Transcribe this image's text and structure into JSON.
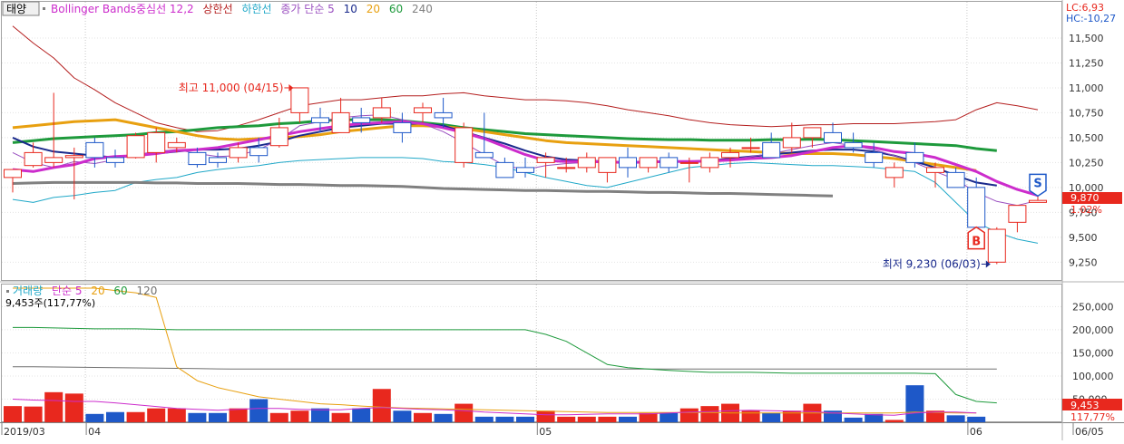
{
  "price_legend": {
    "tag": "태양",
    "bb": "Bollinger Bands중심선 12,2",
    "upper": "상한선",
    "lower": "하한선",
    "ma": "종가 단순 5",
    "p10": "10",
    "p20": "20",
    "p60": "60",
    "p240": "240"
  },
  "vol_legend": {
    "title": "거래량",
    "ma": "단순 5",
    "p20": "20",
    "p60": "60",
    "p120": "120",
    "info": "9,453주(117,77%)"
  },
  "info": {
    "lc": "LC:6,93",
    "hc": "HC:-10,27"
  },
  "badges": {
    "price": "9,870",
    "price_pct": "1.02%",
    "vol": "9,453",
    "vol_pct": "117,77%",
    "buy": "B",
    "sell": "S"
  },
  "colors": {
    "up": "#e8281e",
    "down": "#1e58c8",
    "bb_mid": "#cc2ccc",
    "bb_upper": "#b41e1e",
    "bb_lower": "#20a8c8",
    "ma5": "#9a4fc0",
    "ma10": "#1a2a8c",
    "ma20": "#e8a010",
    "ma60": "#1e9a3c",
    "ma240": "#808080",
    "badge": "#e8281e"
  },
  "chart_data": [
    {
      "type": "candlestick",
      "y_ticks": [
        11500,
        11250,
        11000,
        10750,
        10500,
        10250,
        10000,
        9750,
        9500,
        9250
      ],
      "y_tick_labels": [
        "11,500",
        "11,250",
        "11,000",
        "10,750",
        "10,500",
        "10,250",
        "10,000",
        "9,750",
        "9,500",
        "9,250"
      ],
      "ylim": [
        9080,
        11700
      ],
      "x_tick_labels": [
        "2019/03",
        "04",
        "05",
        "06",
        "06/05"
      ],
      "x_tick_index": [
        0,
        4,
        26,
        47,
        53
      ],
      "annotations": [
        {
          "text": "최고 11,000 (04/15)",
          "index": 14,
          "value": 11000
        },
        {
          "text": "최저 9,230 (06/03)",
          "index": 48,
          "value": 9230
        }
      ],
      "signals": [
        {
          "type": "buy",
          "index": 47,
          "value": 9620
        },
        {
          "type": "sell",
          "index": 50,
          "value": 9950
        }
      ],
      "ohlc": [
        [
          10100,
          10150,
          9950,
          10180
        ],
        [
          10220,
          10450,
          10200,
          10350
        ],
        [
          10250,
          10950,
          10200,
          10300
        ],
        [
          10300,
          10400,
          9880,
          10320
        ],
        [
          10450,
          10500,
          10200,
          10300
        ],
        [
          10300,
          10380,
          10200,
          10250
        ],
        [
          10300,
          10550,
          10290,
          10520
        ],
        [
          10350,
          10600,
          10250,
          10550
        ],
        [
          10400,
          10500,
          10350,
          10450
        ],
        [
          10350,
          10400,
          10200,
          10230
        ],
        [
          10300,
          10350,
          10200,
          10250
        ],
        [
          10300,
          10450,
          10250,
          10400
        ],
        [
          10400,
          10500,
          10250,
          10320
        ],
        [
          10420,
          10700,
          10400,
          10600
        ],
        [
          10750,
          11000,
          10650,
          11000
        ],
        [
          10700,
          10800,
          10550,
          10650
        ],
        [
          10550,
          10900,
          10550,
          10750
        ],
        [
          10700,
          10800,
          10550,
          10650
        ],
        [
          10700,
          10900,
          10650,
          10800
        ],
        [
          10650,
          10750,
          10450,
          10550
        ],
        [
          10750,
          10850,
          10650,
          10800
        ],
        [
          10750,
          10900,
          10600,
          10700
        ],
        [
          10250,
          10650,
          10200,
          10600
        ],
        [
          10350,
          10750,
          10300,
          10300
        ],
        [
          10250,
          10300,
          10100,
          10100
        ],
        [
          10200,
          10300,
          10100,
          10150
        ],
        [
          10250,
          10350,
          10100,
          10300
        ],
        [
          10200,
          10300,
          10150,
          10200
        ],
        [
          10200,
          10350,
          10150,
          10300
        ],
        [
          10150,
          10300,
          10050,
          10300
        ],
        [
          10300,
          10400,
          10100,
          10200
        ],
        [
          10200,
          10300,
          10150,
          10300
        ],
        [
          10300,
          10350,
          10150,
          10200
        ],
        [
          10250,
          10300,
          10050,
          10250
        ],
        [
          10200,
          10350,
          10150,
          10300
        ],
        [
          10300,
          10400,
          10200,
          10350
        ],
        [
          10400,
          10500,
          10350,
          10400
        ],
        [
          10450,
          10550,
          10300,
          10300
        ],
        [
          10400,
          10650,
          10350,
          10500
        ],
        [
          10500,
          10600,
          10400,
          10600
        ],
        [
          10550,
          10650,
          10450,
          10450
        ],
        [
          10450,
          10550,
          10350,
          10400
        ],
        [
          10350,
          10450,
          10200,
          10250
        ],
        [
          10100,
          10250,
          10000,
          10200
        ],
        [
          10350,
          10450,
          10200,
          10250
        ],
        [
          10150,
          10250,
          10000,
          10200
        ],
        [
          10150,
          10200,
          10050,
          10000
        ],
        [
          10000,
          10100,
          9600,
          9600
        ],
        [
          9250,
          9600,
          9230,
          9580
        ],
        [
          9650,
          9750,
          9550,
          9820
        ],
        [
          9850,
          9950,
          9850,
          9870
        ]
      ],
      "bb_middle": [
        10180,
        10160,
        10200,
        10230,
        10290,
        10310,
        10320,
        10340,
        10370,
        10380,
        10400,
        10440,
        10480,
        10520,
        10560,
        10590,
        10620,
        10640,
        10650,
        10660,
        10640,
        10600,
        10550,
        10490,
        10410,
        10330,
        10270,
        10260,
        10260,
        10255,
        10250,
        10255,
        10260,
        10260,
        10265,
        10275,
        10290,
        10300,
        10320,
        10360,
        10400,
        10420,
        10400,
        10360,
        10340,
        10300,
        10230,
        10160,
        10060,
        9980,
        9920
      ],
      "bb_upper": [
        11620,
        11450,
        11300,
        11100,
        10980,
        10850,
        10750,
        10650,
        10600,
        10560,
        10570,
        10620,
        10680,
        10750,
        10820,
        10850,
        10880,
        10880,
        10900,
        10920,
        10920,
        10940,
        10950,
        10920,
        10900,
        10880,
        10880,
        10870,
        10850,
        10820,
        10780,
        10750,
        10720,
        10680,
        10650,
        10630,
        10620,
        10610,
        10620,
        10630,
        10630,
        10640,
        10640,
        10640,
        10650,
        10660,
        10680,
        10780,
        10850,
        10820,
        10780
      ],
      "bb_lower": [
        9880,
        9850,
        9900,
        9920,
        9950,
        9970,
        10050,
        10080,
        10100,
        10150,
        10180,
        10200,
        10220,
        10250,
        10270,
        10280,
        10290,
        10300,
        10300,
        10300,
        10290,
        10260,
        10250,
        10230,
        10200,
        10150,
        10100,
        10060,
        10020,
        10000,
        10050,
        10100,
        10150,
        10200,
        10220,
        10240,
        10250,
        10240,
        10230,
        10220,
        10220,
        10210,
        10200,
        10180,
        10160,
        10050,
        9850,
        9650,
        9550,
        9480,
        9440
      ],
      "ma5": [
        10350,
        10250,
        10200,
        10260,
        10240,
        10280,
        10330,
        10360,
        10380,
        10340,
        10310,
        10320,
        10380,
        10480,
        10620,
        10660,
        10700,
        10720,
        10730,
        10680,
        10640,
        10560,
        10450,
        10330,
        10220,
        10180,
        10220,
        10240,
        10250,
        10260,
        10250,
        10260,
        10270,
        10250,
        10260,
        10280,
        10310,
        10340,
        10380,
        10420,
        10450,
        10420,
        10380,
        10320,
        10250,
        10160,
        10080,
        9950,
        9860,
        9820,
        9870
      ],
      "ma10": [
        10500,
        10410,
        10360,
        10340,
        10320,
        10300,
        10320,
        10340,
        10360,
        10380,
        10380,
        10390,
        10420,
        10460,
        10520,
        10560,
        10600,
        10620,
        10640,
        10640,
        10640,
        10620,
        10560,
        10500,
        10440,
        10370,
        10310,
        10280,
        10270,
        10260,
        10250,
        10260,
        10260,
        10260,
        10270,
        10290,
        10310,
        10330,
        10350,
        10370,
        10380,
        10380,
        10360,
        10320,
        10260,
        10200,
        10120,
        10050,
        10020
      ],
      "ma20": [
        10600,
        10620,
        10640,
        10660,
        10670,
        10680,
        10640,
        10600,
        10560,
        10520,
        10490,
        10480,
        10490,
        10500,
        10510,
        10530,
        10560,
        10580,
        10600,
        10620,
        10620,
        10610,
        10590,
        10560,
        10530,
        10500,
        10470,
        10450,
        10440,
        10430,
        10420,
        10410,
        10400,
        10390,
        10380,
        10370,
        10360,
        10350,
        10340,
        10340,
        10340,
        10330,
        10310,
        10290,
        10260,
        10230,
        10200,
        10170
      ],
      "ma60": [
        10450,
        10470,
        10490,
        10500,
        10510,
        10520,
        10530,
        10550,
        10560,
        10580,
        10600,
        10610,
        10620,
        10640,
        10650,
        10670,
        10680,
        10680,
        10680,
        10670,
        10650,
        10630,
        10600,
        10580,
        10560,
        10540,
        10530,
        10520,
        10510,
        10500,
        10490,
        10485,
        10480,
        10480,
        10475,
        10475,
        10475,
        10480,
        10480,
        10485,
        10480,
        10470,
        10460,
        10450,
        10440,
        10430,
        10420,
        10390,
        10370
      ],
      "ma240": [
        10040,
        10045,
        10050,
        10050,
        10050,
        10050,
        10050,
        10045,
        10045,
        10040,
        10040,
        10040,
        10035,
        10030,
        10030,
        10025,
        10020,
        10020,
        10015,
        10010,
        10000,
        9990,
        9985,
        9980,
        9975,
        9970,
        9970,
        9965,
        9960,
        9960,
        9955,
        9950,
        9950,
        9945,
        9940,
        9940,
        9935,
        9930,
        9925,
        9920,
        9915
      ]
    },
    {
      "type": "bar",
      "y_ticks": [
        250000,
        200000,
        150000,
        100000,
        50000
      ],
      "y_tick_labels": [
        "250,000",
        "200,000",
        "150,000",
        "100,000",
        "50,000"
      ],
      "ylim": [
        0,
        290000
      ],
      "volume": [
        35000,
        34000,
        65000,
        62000,
        18000,
        22000,
        22000,
        30000,
        30000,
        20000,
        20000,
        30000,
        50000,
        20000,
        25000,
        30000,
        20000,
        30000,
        72000,
        25000,
        20000,
        18000,
        40000,
        12000,
        12000,
        12000,
        25000,
        12000,
        12000,
        12000,
        12000,
        20000,
        20000,
        30000,
        35000,
        40000,
        25000,
        20000,
        25000,
        40000,
        25000,
        10000,
        18000,
        5000,
        80000,
        25000,
        15000,
        12000
      ],
      "ma5": [
        50000,
        48000,
        47000,
        45000,
        45000,
        42000,
        38000,
        34000,
        30000,
        28000,
        26000,
        28000,
        30000,
        30000,
        28000,
        27000,
        27000,
        30000,
        32000,
        30000,
        28000,
        27000,
        25000,
        22000,
        20000,
        18000,
        16000,
        16000,
        17000,
        18000,
        18000,
        18000,
        20000,
        22000,
        23000,
        25000,
        26000,
        25000,
        24000,
        23000,
        20000,
        18000,
        16000,
        15000,
        20000,
        22000,
        22000,
        20000
      ],
      "ma20": [
        290000,
        290000,
        290000,
        290000,
        290000,
        285000,
        280000,
        270000,
        120000,
        90000,
        75000,
        65000,
        55000,
        50000,
        45000,
        40000,
        38000,
        35000,
        33000,
        31000,
        30000,
        29000,
        28000,
        27000,
        26000,
        25000,
        24000,
        23000,
        22000,
        21000,
        21000,
        21000,
        21000,
        21000,
        21000,
        20000,
        20000,
        20000,
        20000,
        20000,
        20000,
        20000,
        20000,
        20000,
        22000,
        21000,
        20000,
        20000
      ],
      "ma60": [
        205000,
        205000,
        204000,
        203000,
        202000,
        202000,
        202000,
        201000,
        200000,
        200000,
        200000,
        200000,
        200000,
        200000,
        200000,
        200000,
        200000,
        200000,
        200000,
        200000,
        200000,
        200000,
        200000,
        200000,
        200000,
        200000,
        190000,
        175000,
        150000,
        125000,
        118000,
        115000,
        112000,
        110000,
        108000,
        108000,
        108000,
        107000,
        106000,
        106000,
        106000,
        106000,
        106000,
        106000,
        106000,
        105000,
        60000,
        45000,
        42000
      ],
      "ma120": [
        120000,
        120000,
        119500,
        119000,
        118500,
        118000,
        117500,
        117000,
        116500,
        116000,
        115500,
        115000,
        115000,
        115000,
        115000,
        115000,
        115000,
        115000,
        115000,
        115000,
        115000,
        115000,
        115000,
        115000,
        115000,
        115000,
        115000,
        115000,
        115000,
        115000,
        115000,
        115000,
        115000,
        115000,
        115000,
        115000,
        115000,
        115000,
        115000,
        115000,
        115000,
        115000,
        115000,
        115000,
        115000,
        115000,
        115000,
        115000,
        115000
      ]
    }
  ]
}
